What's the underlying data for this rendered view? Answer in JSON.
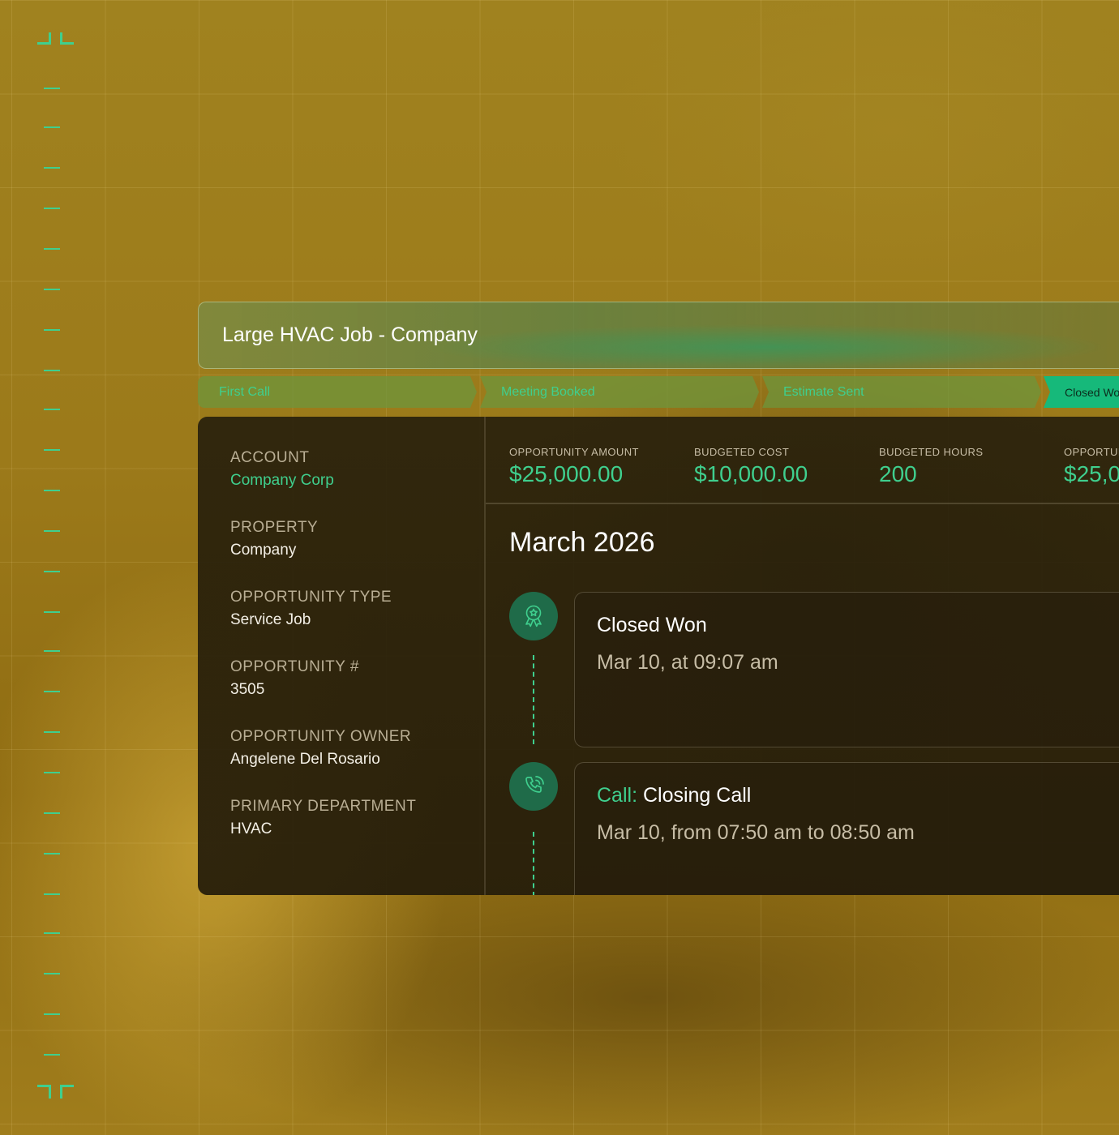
{
  "opportunity": {
    "title": "Large HVAC Job - Company"
  },
  "stages": [
    {
      "label": "First Call",
      "active": false
    },
    {
      "label": "Meeting Booked",
      "active": false
    },
    {
      "label": "Estimate Sent",
      "active": false
    },
    {
      "label": "Closed Wo",
      "active": true
    }
  ],
  "details": [
    {
      "label": "ACCOUNT",
      "value": "Company Corp",
      "is_link": true
    },
    {
      "label": "PROPERTY",
      "value": "Company",
      "is_link": false
    },
    {
      "label": "OPPORTUNITY TYPE",
      "value": "Service Job",
      "is_link": false
    },
    {
      "label": "OPPORTUNITY #",
      "value": "3505",
      "is_link": false
    },
    {
      "label": "OPPORTUNITY OWNER",
      "value": "Angelene Del Rosario",
      "is_link": false
    },
    {
      "label": "PRIMARY DEPARTMENT",
      "value": "HVAC",
      "is_link": false
    }
  ],
  "metrics": [
    {
      "label": "OPPORTUNITY AMOUNT",
      "value": "$25,000.00"
    },
    {
      "label": "BUDGETED COST",
      "value": "$10,000.00"
    },
    {
      "label": "BUDGETED HOURS",
      "value": "200"
    },
    {
      "label": "OPPORTUN",
      "value": "$25,0"
    }
  ],
  "timeline": {
    "month": "March 2026",
    "events": [
      {
        "icon": "award-ribbon-icon",
        "prefix": "",
        "title": "Closed Won",
        "date": "Mar 10, at 09:07 am"
      },
      {
        "icon": "phone-call-icon",
        "prefix": "Call:",
        "title": " Closing Call",
        "date": "Mar 10, from 07:50 am to 08:50 am"
      }
    ]
  },
  "colors": {
    "accent": "#3fcf8e",
    "active_stage": "#16b97a",
    "panel_bg": "#281f0c",
    "background": "#a37f1d"
  }
}
